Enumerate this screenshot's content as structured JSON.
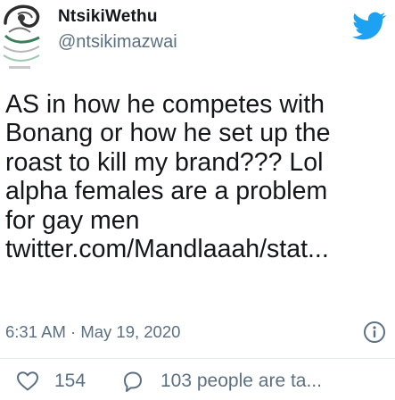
{
  "tweet": {
    "author": {
      "display_name": "NtsikiWethu",
      "handle": "@ntsikimazwai"
    },
    "text": "AS in how he competes with\nBonang or how he set up the\nroast to kill my brand??? Lol\nalpha females are a problem\nfor gay men\ntwitter.com/Mandlaaah/stat...",
    "timestamp": "6:31 AM · May 19, 2020",
    "actions": {
      "likes": "154",
      "replies": "103 people are ta..."
    }
  },
  "icons": {
    "brand": "twitter-bird-icon",
    "info": "info-icon",
    "like": "heart-icon",
    "reply": "comment-bubble-icon"
  },
  "colors": {
    "twitter_blue": "#1da1f2",
    "primary_text": "#14171a",
    "secondary_text": "#5b7083",
    "divider": "#e6ecf0"
  }
}
